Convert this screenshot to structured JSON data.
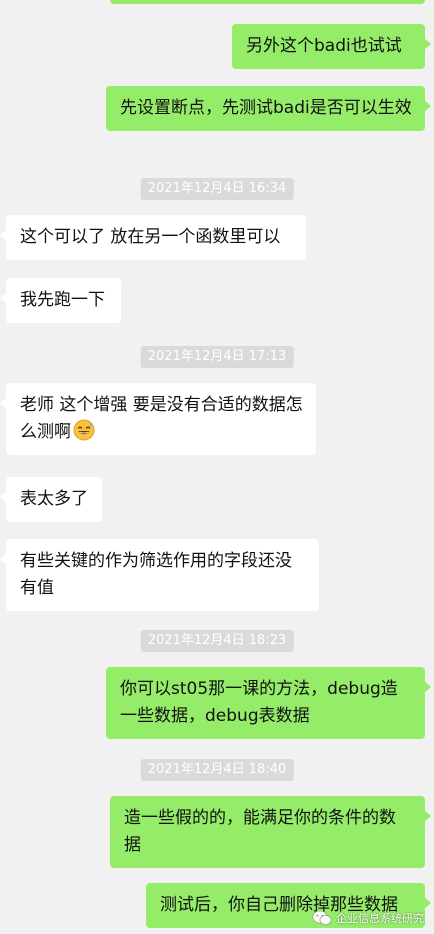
{
  "colors": {
    "background": "#f1f1f1",
    "sent_bubble": "#95ec69",
    "received_bubble": "#ffffff",
    "timestamp_bg": "#dadada"
  },
  "messages": [
    {
      "side": "me",
      "text": "另外这个badi也试试"
    },
    {
      "side": "me",
      "text": "先设置断点，先测试badi是否可以生效"
    },
    {
      "time": "2021年12月4日 16:34"
    },
    {
      "side": "them",
      "text": "这个可以了 放在另一个函数里可以"
    },
    {
      "side": "them",
      "text": "我先跑一下"
    },
    {
      "time": "2021年12月4日 17:13"
    },
    {
      "side": "them",
      "text": "老师 这个增强 要是没有合适的数据怎么测啊",
      "emoji": "grinning-sweat-emoji"
    },
    {
      "side": "them",
      "text": "表太多了"
    },
    {
      "side": "them",
      "text": "有些关键的作为筛选作用的字段还没有值"
    },
    {
      "time": "2021年12月4日 18:23"
    },
    {
      "side": "me",
      "text": "你可以st05那一课的方法，debug造一些数据，debug表数据"
    },
    {
      "time": "2021年12月4日 18:40"
    },
    {
      "side": "me",
      "text": "造一些假的的，能满足你的条件的数据"
    },
    {
      "side": "me",
      "text": "测试后，你自己删除掉那些数据"
    }
  ],
  "watermark": {
    "icon": "wechat-official-account-icon",
    "text": "企业信息系统研究"
  }
}
